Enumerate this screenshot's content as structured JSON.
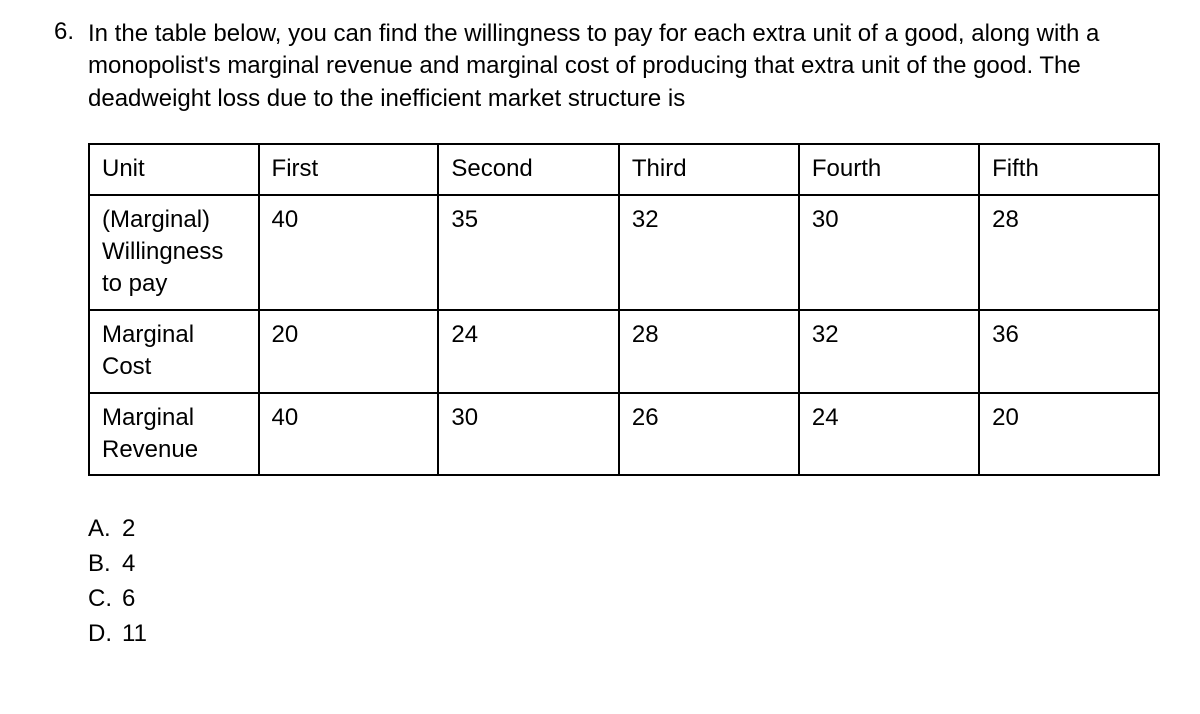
{
  "question": {
    "number": "6.",
    "text": "In the table below, you can find the willingness to pay for each extra unit of a good, along with a monopolist's marginal revenue and marginal cost of producing that extra unit of the good. The deadweight loss due to the inefficient market structure is"
  },
  "table": {
    "header": {
      "rowLabel": "Unit",
      "cols": [
        "First",
        "Second",
        "Third",
        "Fourth",
        "Fifth"
      ]
    },
    "rows": [
      {
        "label": "(Marginal) Willingness to pay",
        "values": [
          "40",
          "35",
          "32",
          "30",
          "28"
        ]
      },
      {
        "label": "Marginal Cost",
        "values": [
          "20",
          "24",
          "28",
          "32",
          "36"
        ]
      },
      {
        "label": "Marginal Revenue",
        "values": [
          "40",
          "30",
          "26",
          "24",
          "20"
        ]
      }
    ]
  },
  "choices": [
    {
      "letter": "A.",
      "text": "2"
    },
    {
      "letter": "B.",
      "text": "4"
    },
    {
      "letter": "C.",
      "text": "6"
    },
    {
      "letter": "D.",
      "text": "11"
    }
  ],
  "chart_data": {
    "type": "table",
    "columns": [
      "Unit",
      "First",
      "Second",
      "Third",
      "Fourth",
      "Fifth"
    ],
    "rows": [
      [
        "(Marginal) Willingness to pay",
        40,
        35,
        32,
        30,
        28
      ],
      [
        "Marginal Cost",
        20,
        24,
        28,
        32,
        36
      ],
      [
        "Marginal Revenue",
        40,
        30,
        26,
        24,
        20
      ]
    ]
  }
}
